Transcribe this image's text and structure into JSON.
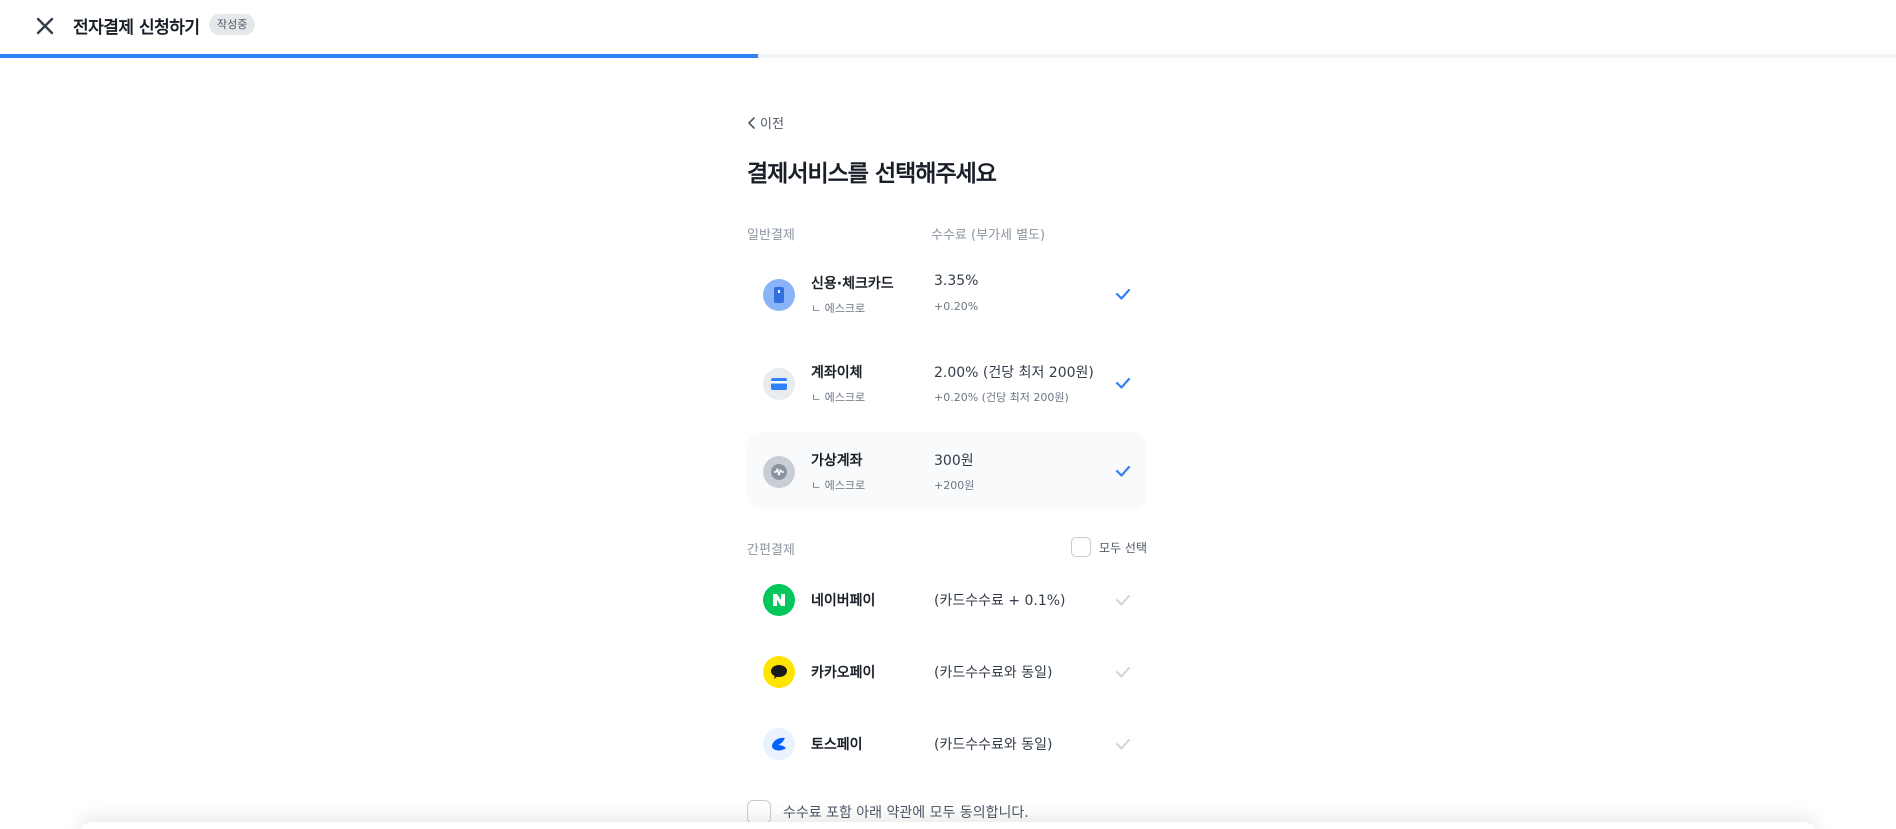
{
  "header": {
    "title": "전자결제 신청하기",
    "status": "작성중",
    "progress": 0.4
  },
  "nav": {
    "back_label": "이전"
  },
  "page": {
    "title": "결제서비스를 선택해주세요"
  },
  "general": {
    "label": "일반결제",
    "fee_header": "수수료 (부가세 별도)",
    "items": [
      {
        "name": "신용·체크카드",
        "sub": "ㄴ 에스크로",
        "fee": "3.35%",
        "fee_sub": "+0.20%",
        "icon": "credit-card-icon",
        "checked": true
      },
      {
        "name": "계좌이체",
        "sub": "ㄴ 에스크로",
        "fee": "2.00% (건당 최저 200원)",
        "fee_sub": "+0.20% (건당 최저 200원)",
        "icon": "bank-transfer-icon",
        "checked": true
      },
      {
        "name": "가상계좌",
        "sub": "ㄴ 에스크로",
        "fee": "300원",
        "fee_sub": "+200원",
        "icon": "virtual-account-icon",
        "checked": true
      }
    ]
  },
  "simple": {
    "label": "간편결제",
    "select_all_label": "모두 선택",
    "items": [
      {
        "name": "네이버페이",
        "fee": "(카드수수료 + 0.1%)",
        "icon": "naver-pay-icon",
        "checked": false
      },
      {
        "name": "카카오페이",
        "fee": "(카드수수료와 동일)",
        "icon": "kakao-pay-icon",
        "checked": false
      },
      {
        "name": "토스페이",
        "fee": "(카드수수료와 동일)",
        "icon": "toss-pay-icon",
        "checked": false
      }
    ]
  },
  "agreement": {
    "label": "수수료 포함 아래 약관에 모두 동의합니다."
  },
  "colors": {
    "accent": "#3182f6",
    "check_active": "#3182f6",
    "check_inactive": "#d1d6db",
    "naver": "#03c75a",
    "kakao": "#fee500",
    "toss": "#0064ff"
  }
}
